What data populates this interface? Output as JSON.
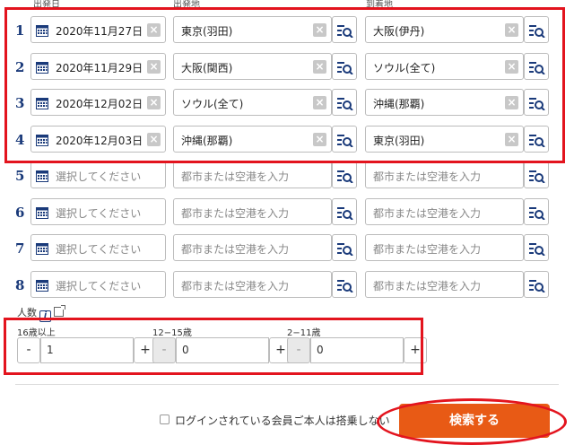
{
  "headers": {
    "date": "出発日",
    "origin": "出発地",
    "destination": "到着地"
  },
  "calendar_icon": "calendar-icon",
  "clear_icon": "clear-icon",
  "search_list_icon": "search-list-icon",
  "flights": [
    {
      "num": "1",
      "date": "2020年11月27日",
      "origin": "東京(羽田)",
      "destination": "大阪(伊丹)",
      "filled": true
    },
    {
      "num": "2",
      "date": "2020年11月29日",
      "origin": "大阪(関西)",
      "destination": "ソウル(全て)",
      "filled": true
    },
    {
      "num": "3",
      "date": "2020年12月02日",
      "origin": "ソウル(全て)",
      "destination": "沖縄(那覇)",
      "filled": true
    },
    {
      "num": "4",
      "date": "2020年12月03日",
      "origin": "沖縄(那覇)",
      "destination": "東京(羽田)",
      "filled": true
    },
    {
      "num": "5",
      "date": "",
      "origin": "",
      "destination": "",
      "filled": false
    },
    {
      "num": "6",
      "date": "",
      "origin": "",
      "destination": "",
      "filled": false
    },
    {
      "num": "7",
      "date": "",
      "origin": "",
      "destination": "",
      "filled": false
    },
    {
      "num": "8",
      "date": "",
      "origin": "",
      "destination": "",
      "filled": false
    }
  ],
  "placeholders": {
    "date": "選択してください",
    "city": "都市または空港を入力"
  },
  "passengers": {
    "label": "人数",
    "info_icon": "i",
    "groups": [
      {
        "label": "16歳以上",
        "value": "1",
        "minus": "-",
        "plus": "+",
        "minus_disabled": false
      },
      {
        "label": "12−15歳",
        "value": "0",
        "minus": "-",
        "plus": "+",
        "minus_disabled": true
      },
      {
        "label": "2−11歳",
        "value": "0",
        "minus": "-",
        "plus": "+",
        "minus_disabled": true
      }
    ]
  },
  "member_checkbox": {
    "label": "ログインされている会員ご本人は搭乗しない",
    "checked": false
  },
  "search_button": "検索する",
  "colors": {
    "accent": "#e85a15",
    "highlight": "#e3141e",
    "number": "#1a3a7a"
  }
}
